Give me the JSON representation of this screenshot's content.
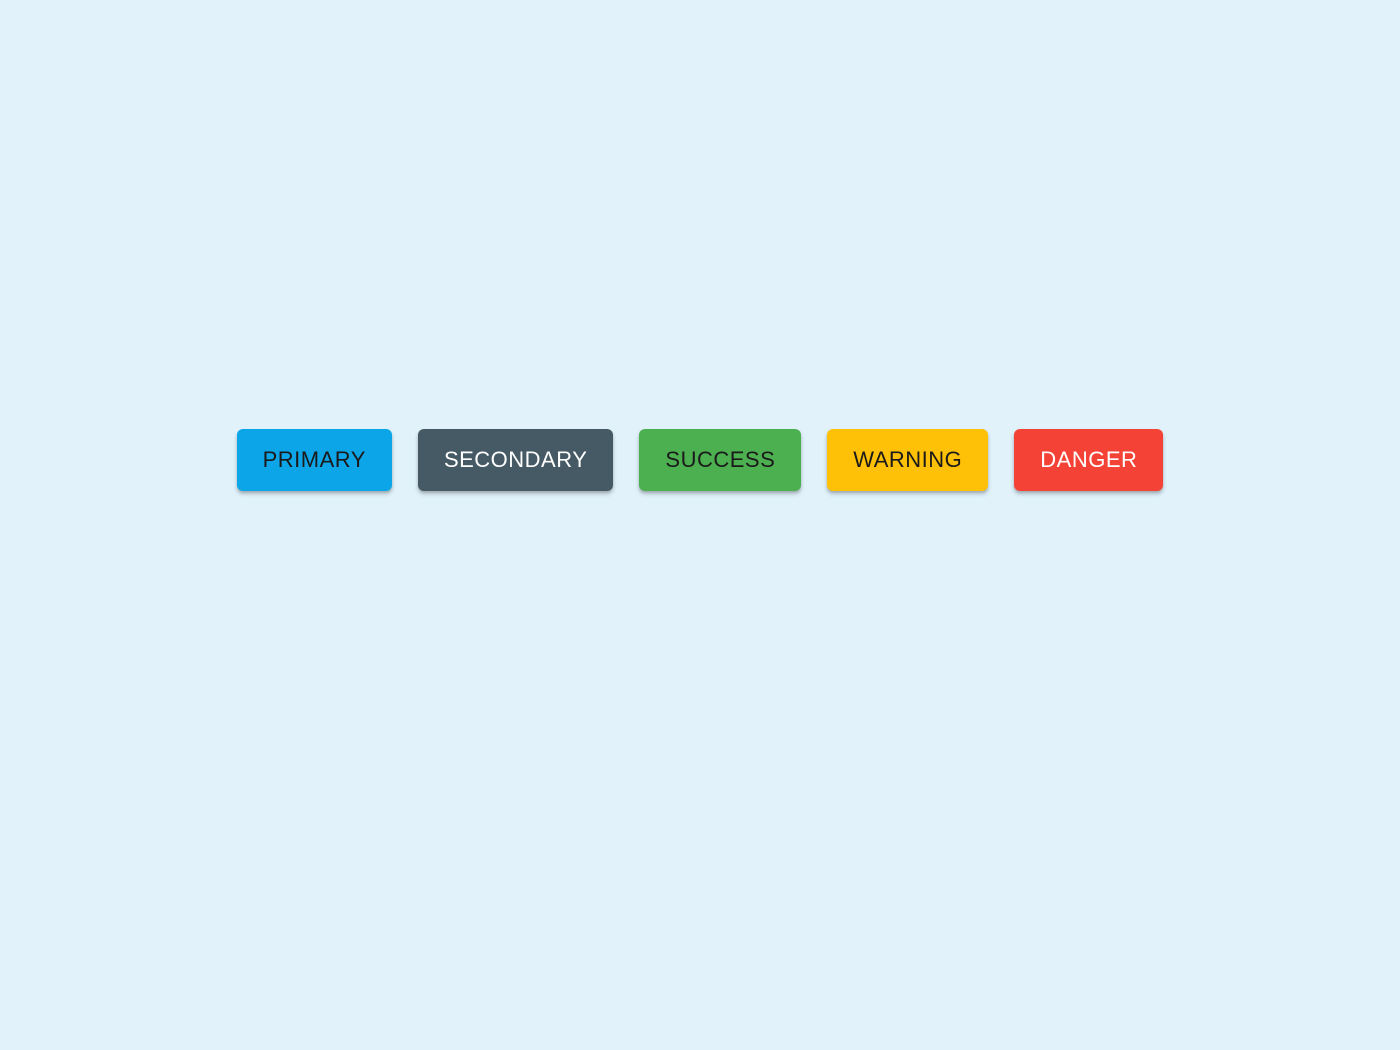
{
  "buttons": {
    "primary": {
      "label": "PRIMARY"
    },
    "secondary": {
      "label": "SECONDARY"
    },
    "success": {
      "label": "SUCCESS"
    },
    "warning": {
      "label": "WARNING"
    },
    "danger": {
      "label": "DANGER"
    }
  },
  "colors": {
    "background": "#E1F2FB",
    "primary": "#0CA5E8",
    "secondary": "#455A64",
    "success": "#4CAF50",
    "warning": "#FFC107",
    "danger": "#F44336"
  }
}
